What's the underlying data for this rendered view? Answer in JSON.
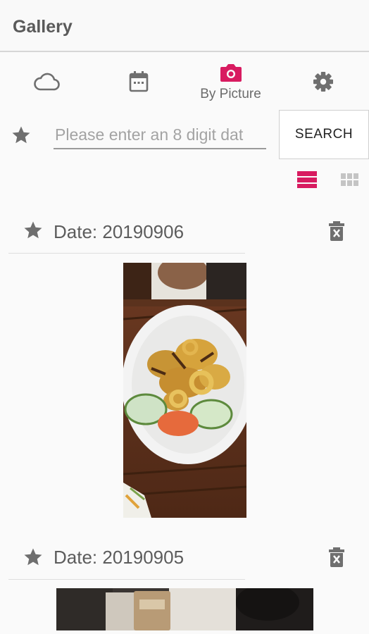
{
  "app": {
    "title": "Gallery"
  },
  "tabs": [
    {
      "icon": "cloud-icon",
      "label": ""
    },
    {
      "icon": "calendar-icon",
      "label": ""
    },
    {
      "icon": "camera-icon",
      "label": "By Picture",
      "active": true
    },
    {
      "icon": "gear-icon",
      "label": ""
    }
  ],
  "search": {
    "value": "",
    "placeholder": "Please enter an 8 digit dat",
    "button_label": "SEARCH"
  },
  "view_modes": [
    {
      "icon": "list-view-icon",
      "active": true
    },
    {
      "icon": "grid-view-icon",
      "active": false
    }
  ],
  "entries": [
    {
      "date_label": "Date: 20190906",
      "photo": "plate of fried squid with cucumber and tomato slices"
    },
    {
      "date_label": "Date: 20190905",
      "photo": "cafe table with a paper cup"
    }
  ],
  "colors": {
    "accent": "#d81b60",
    "icon_gray": "#6f6f6f",
    "background": "#fafafa"
  }
}
